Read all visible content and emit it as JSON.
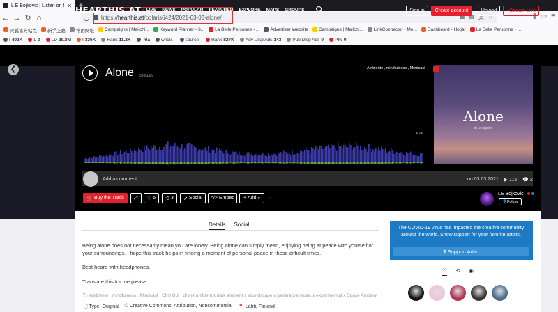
{
  "browser": {
    "tab_title": "L E Bojkovic | Listen on hear",
    "url_prefix": "https://",
    "url_domain": "hearthis.at",
    "url_path": "/polaris6424/2021-03-03-alone/"
  },
  "bookmarks": [
    {
      "label": "火狐官方站点",
      "color": "#e8632a"
    },
    {
      "label": "新手上路",
      "color": "#e8632a"
    },
    {
      "label": "常用网址",
      "color": "#888888"
    },
    {
      "label": "Campaigns | Mailchi...",
      "color": "#ffcc00"
    },
    {
      "label": "Keyword Planner - 3...",
      "color": "#34a853"
    },
    {
      "label": "La Belle Personne - ...",
      "color": "#e5202c"
    },
    {
      "label": "Advertiser Website",
      "color": "#555555"
    },
    {
      "label": "Campaigns | Mailchi...",
      "color": "#ffcc00"
    },
    {
      "label": "LinkConnector - Me...",
      "color": "#888888"
    },
    {
      "label": "Dashboard - Hotjar",
      "color": "#e8632a"
    },
    {
      "label": "La Belle Personne - ...",
      "color": "#e5202c"
    }
  ],
  "extensions": [
    {
      "label": "I",
      "value": "402K",
      "color": "#555555"
    },
    {
      "label": "L",
      "value": "0",
      "color": "#e5202c"
    },
    {
      "label": "LD",
      "value": "29.8M",
      "color": "#e5202c"
    },
    {
      "label": "I",
      "value": "336K",
      "color": "#e8632a"
    },
    {
      "label": "Rank",
      "value": "11.2K",
      "color": "#888888"
    },
    {
      "label": "",
      "value": "n/a",
      "color": "#555555"
    },
    {
      "label": "whois",
      "value": "",
      "color": "#555555"
    },
    {
      "label": "source",
      "value": "",
      "color": "#555555"
    },
    {
      "label": "Rank",
      "value": "827K",
      "color": "#e5202c"
    },
    {
      "label": "Adv Disp Ads",
      "value": "143",
      "color": "#888888"
    },
    {
      "label": "Pub Disp Ads",
      "value": "0",
      "color": "#888888"
    },
    {
      "label": "PIN",
      "value": "0",
      "color": "#e5202c"
    }
  ],
  "site": {
    "logo": "HEARTHIS.AT",
    "nav": [
      "LIVE",
      "NEWS",
      "POPULAR",
      "FEATURED",
      "EXPLORE",
      "MAPS",
      "GROUPS"
    ],
    "signin": "Sign in",
    "create_account": "Create account",
    "upload": "Upload",
    "stream_live": "Stream Live"
  },
  "track": {
    "title": "Alone",
    "bitrate": "320kbit/s",
    "tags_top": "Ambiente , mindfulness , Mindcast",
    "duration": "4:24",
    "cover_title": "Alone",
    "cover_sub": "by LE Bojkovic",
    "comment_placeholder": "Add a comment",
    "date": "on 03.03.2021",
    "plays": "115",
    "comments": "2",
    "progress": 0
  },
  "actions": {
    "buy": "Buy the Track",
    "likes": "5",
    "reposts": "3",
    "social": "Social",
    "embed": "Embed",
    "add": "Add",
    "more": "···"
  },
  "artist": {
    "name": "LE Bojkovic",
    "follow": "Follow",
    "dot_colors": [
      "#e5202c",
      "#1c7bc4"
    ]
  },
  "tabs": {
    "details": "Details",
    "social": "Social"
  },
  "description": {
    "text": "Being alone does not necessarily mean you are lonely. Being alone can simply mean, enjoying being at peace with yourself or your surroundings. I hope this track helps in finding a moment of personal peace in these difficult times.",
    "best": "Best heard with headphones.",
    "translate": "Translate this for me please",
    "tags": "Ambiente , mindfulness , Mindcast , Chill Out , drone ambient x dark ambient x soundscape x generative music x experimental x Space Ambient",
    "type": "Type: Original",
    "license": "© Creative Commons: Attribution, Noncommercial",
    "location": "Lahti, Finland"
  },
  "sidebar": {
    "covid_text": "The COVID-19 virus has impacted the creative community around the world. Show support for your favorite artists.",
    "support": "$ Support Artist",
    "liker_colors": [
      "#111111",
      "#f2c4d8",
      "#b03050",
      "#333333",
      "#4a6a8a"
    ]
  },
  "colors": {
    "accent": "#e5202c",
    "covid_blue": "#1c7bc4"
  }
}
